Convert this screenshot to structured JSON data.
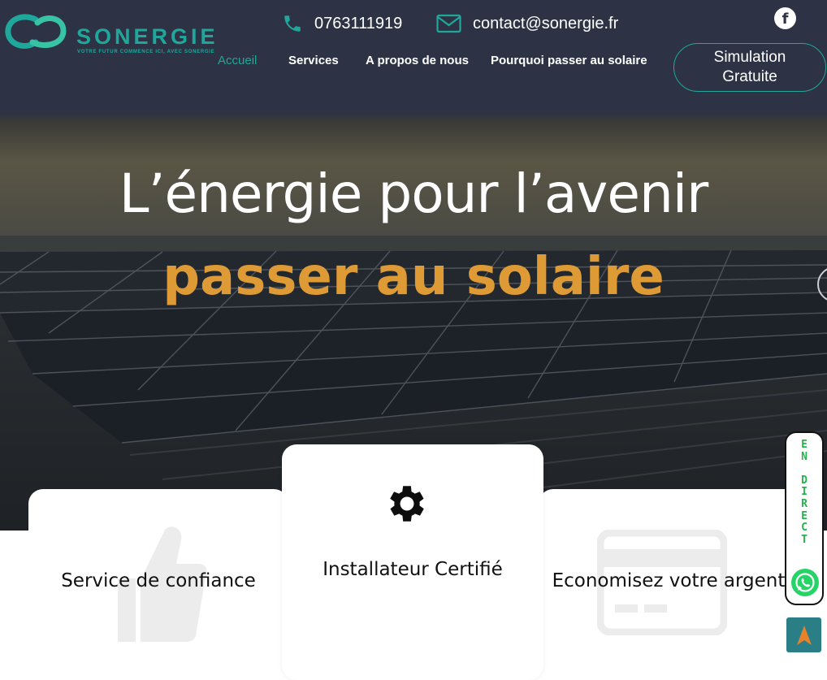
{
  "brand": {
    "name": "SONERGIE",
    "tagline": "VOTRE FUTUR COMMENCE ICI, AVEC SONERGIE",
    "accent_color": "#1fa79c",
    "header_color": "#2d3344",
    "highlight_color": "#dd9a35"
  },
  "contact": {
    "phone": "0763111919",
    "phone_icon": "phone-icon",
    "email": "contact@sonergie.fr",
    "email_icon": "envelope-icon",
    "social_icon": "facebook-icon",
    "social_glyph": "f"
  },
  "nav": {
    "items": [
      {
        "label": "Accueil",
        "active": true
      },
      {
        "label": "Services",
        "active": false
      },
      {
        "label": "A propos de nous",
        "active": false
      },
      {
        "label": "Pourquoi passer au solaire",
        "active": false
      }
    ],
    "cta_line1": "Simulation",
    "cta_line2": "Gratuite"
  },
  "hero": {
    "headline": "L’énergie pour l’avenir",
    "subheadline": "passer au solaire"
  },
  "features": [
    {
      "title": "Service de confiance",
      "icon": "thumbs-up-icon"
    },
    {
      "title": "Installateur Certifié",
      "icon": "gear-icon"
    },
    {
      "title": "Economisez votre argent",
      "icon": "credit-card-icon"
    }
  ],
  "whatsapp": {
    "label_letters": [
      "E",
      "N",
      "",
      "D",
      "I",
      "R",
      "E",
      "C",
      "T"
    ],
    "icon": "whatsapp-icon"
  },
  "scroll_top": {
    "icon": "arrow-up-icon"
  }
}
